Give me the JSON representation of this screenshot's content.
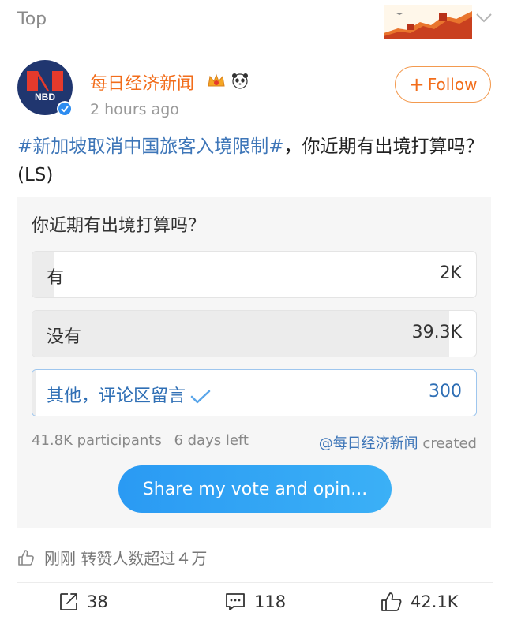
{
  "topbar": {
    "label": "Top"
  },
  "post": {
    "username": "每日经济新闻",
    "time": "2 hours ago",
    "follow_label": "Follow",
    "hashtag": "#新加坡取消中国旅客入境限制#",
    "text_rest": "，你近期有出境打算吗？(LS)",
    "avatar_text": "NBD"
  },
  "poll": {
    "question": "你近期有出境打算吗？",
    "options": [
      {
        "label": "有",
        "count": "2K",
        "fraction": 0.048,
        "selected": false
      },
      {
        "label": "没有",
        "count": "39.3K",
        "fraction": 0.94,
        "selected": false
      },
      {
        "label": "其他，评论区留言",
        "count": "300",
        "fraction": 0.007,
        "selected": true
      }
    ],
    "participants": "41.8K participants",
    "days_left": "6 days left",
    "creator_handle": "@每日经济新闻",
    "creator_suffix": "created",
    "share_label": "Share my vote and opin..."
  },
  "like_info": {
    "text": "刚刚 转赞人数超过４万"
  },
  "actions": {
    "repost": "38",
    "comment": "118",
    "like": "42.1K"
  },
  "colors": {
    "accent_orange": "#f26d1b",
    "link_blue": "#3e76b8",
    "share_blue": "#2a9af3"
  }
}
